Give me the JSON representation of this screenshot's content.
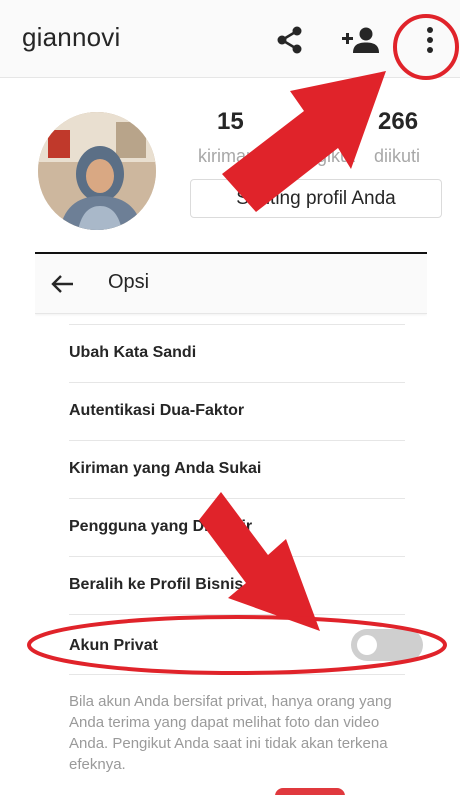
{
  "profile": {
    "username": "giannovi",
    "icons": [
      "share-icon",
      "add-person-icon",
      "more-vertical-icon"
    ],
    "stats": [
      {
        "value": "15",
        "label": "kiriman"
      },
      {
        "value": "",
        "label": "pengikut"
      },
      {
        "value": "266",
        "label": "diikuti"
      }
    ],
    "edit_button": "Sunting profil Anda"
  },
  "options": {
    "title": "Opsi",
    "items": [
      {
        "label": "Ubah Kata Sandi"
      },
      {
        "label": "Autentikasi Dua-Faktor"
      },
      {
        "label": "Kiriman yang Anda Sukai"
      },
      {
        "label": "Pengguna yang Diblokir"
      },
      {
        "label": "Beralih ke Profil Bisnis"
      },
      {
        "label": "Akun Privat"
      }
    ],
    "private_toggle_on": false,
    "private_description": "Bila akun Anda bersifat privat, hanya orang yang Anda terima yang dapat melihat foto dan video Anda. Pengikut Anda saat ini tidak akan terkena efeknya."
  },
  "colors": {
    "annotation_red": "#e0232a",
    "toggle_off": "#cfcfcf"
  }
}
